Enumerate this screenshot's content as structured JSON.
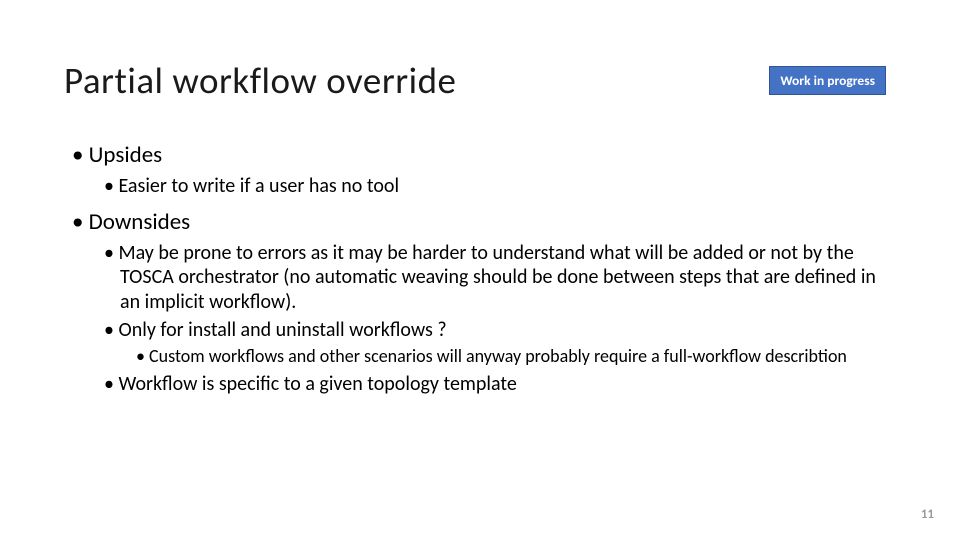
{
  "header": {
    "title": "Partial workflow override",
    "badge": "Work in progress"
  },
  "content": {
    "upsides_label": "Upsides",
    "upsides_item_1": "Easier to write if a user has no tool",
    "downsides_label": "Downsides",
    "downsides_item_1": "May be prone to errors as it may be harder to understand what will be added or not by the TOSCA orchestrator (no automatic weaving should be done between steps that are defined in an implicit workflow).",
    "downsides_item_2": "Only for install and uninstall workflows ?",
    "downsides_item_2_sub": "Custom workflows and other scenarios will anyway probably require a full-workflow describtion",
    "downsides_item_3": "Workflow is specific to a given topology template"
  },
  "page_number": "11"
}
